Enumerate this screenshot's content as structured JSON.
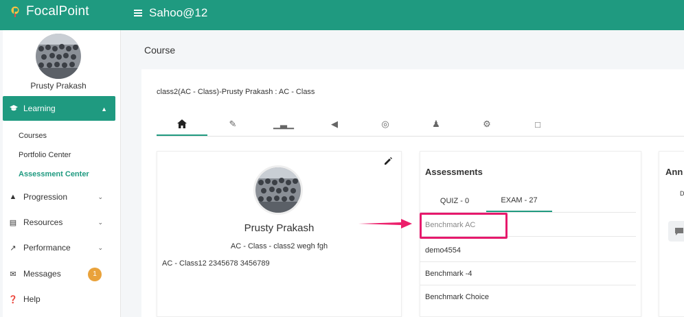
{
  "topbar": {
    "brand": "FocalPoint",
    "user": "Sahoo@12"
  },
  "sidebar": {
    "user_name": "Prusty Prakash",
    "active_section": "Learning",
    "sub_items": [
      "Courses",
      "Portfolio Center",
      "Assessment Center"
    ],
    "items": [
      {
        "label": "Progression",
        "icon": "progression-icon"
      },
      {
        "label": "Resources",
        "icon": "clipboard-icon"
      },
      {
        "label": "Performance",
        "icon": "trend-icon"
      },
      {
        "label": "Messages",
        "icon": "mail-icon",
        "badge": "1"
      },
      {
        "label": "Help",
        "icon": "help-icon"
      }
    ]
  },
  "page": {
    "title": "Course",
    "class_title": "class2(AC - Class)-Prusty Prakash : AC - Class"
  },
  "profile": {
    "name": "Prusty Prakash",
    "sub": "AC - Class - class2 wegh fgh",
    "line": "AC - Class12 2345678  3456789"
  },
  "assessments": {
    "title": "Assessments",
    "tabs": [
      "QUIZ - 0",
      "EXAM - 27"
    ],
    "items": [
      "Benchmark AC",
      "demo4554",
      "Benchmark -4",
      "Benchmark Choice"
    ]
  },
  "announcements": {
    "title": "Ann",
    "d": "D"
  },
  "colors": {
    "primary": "#1f9a80",
    "badge": "#e9a23b",
    "highlight": "#e6196c"
  }
}
